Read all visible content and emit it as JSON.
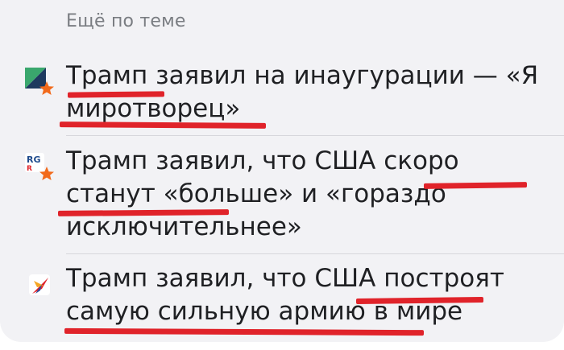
{
  "section": {
    "heading": "Ещё по теме"
  },
  "items": [
    {
      "title": "Трамп заявил на инаугурации — «Я миротворец»",
      "source_icon": "source-logo-geometric-icon"
    },
    {
      "title": "Трамп заявил, что США скоро станут «больше» и «гораздо исключительнее»",
      "source_icon": "source-logo-rg-icon",
      "source_text": "RG"
    },
    {
      "title": "Трамп заявил, что США построят самую сильную армию в мире",
      "source_icon": "source-logo-bird-icon"
    }
  ],
  "colors": {
    "background": "#f2f2f5",
    "text": "#1f2023",
    "heading": "#7a7d82",
    "underline": "#e0232a",
    "badge": "#f26a1b"
  }
}
